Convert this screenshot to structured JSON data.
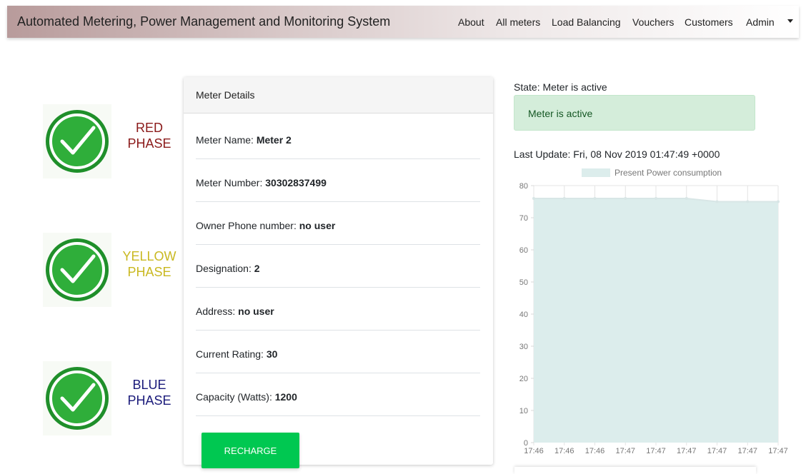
{
  "navbar": {
    "brand": "Automated Metering, Power Management and Monitoring System",
    "links": [
      "About",
      "All meters",
      "Load Balancing",
      "Vouchers",
      "Customers",
      "Admin"
    ]
  },
  "phases": [
    {
      "label_line1": "RED",
      "label_line2": "PHASE",
      "color": "#8b1a1a",
      "icon": "check-circle-icon"
    },
    {
      "label_line1": "YELLOW",
      "label_line2": "PHASE",
      "color": "#c9b820",
      "icon": "check-circle-icon"
    },
    {
      "label_line1": "BLUE",
      "label_line2": "PHASE",
      "color": "#1a1a7a",
      "icon": "check-circle-icon"
    }
  ],
  "meter_card": {
    "title": "Meter Details",
    "rows": [
      {
        "label": "Meter Name: ",
        "value": "Meter 2"
      },
      {
        "label": "Meter Number: ",
        "value": "30302837499"
      },
      {
        "label": "Owner Phone number: ",
        "value": "no user"
      },
      {
        "label": "Designation: ",
        "value": "2"
      },
      {
        "label": "Address: ",
        "value": "no user"
      },
      {
        "label": "Current Rating: ",
        "value": "30"
      },
      {
        "label": "Capacity (Watts): ",
        "value": "1200"
      }
    ],
    "recharge_label": "RECHARGE",
    "recharge_color": "#00c851"
  },
  "status": {
    "state_label": "State: Meter is active",
    "alert_text": "Meter is active",
    "last_update": "Last Update: Fri, 08 Nov 2019 01:47:49 +0000"
  },
  "chart_data": {
    "type": "area",
    "legend": "Present Power consumption",
    "legend_placement": "top",
    "x": [
      "17:46",
      "17:46",
      "17:46",
      "17:47",
      "17:47",
      "17:47",
      "17:47",
      "17:47",
      "17:47"
    ],
    "values": [
      76,
      76,
      76,
      76,
      76,
      76,
      75,
      75,
      75
    ],
    "ylim": [
      0,
      80
    ],
    "yticks": [
      0,
      10,
      20,
      30,
      40,
      50,
      60,
      70,
      80
    ],
    "fill_color": "#dcedec",
    "line_color": "#d8e6e6",
    "grid": "vertical"
  }
}
